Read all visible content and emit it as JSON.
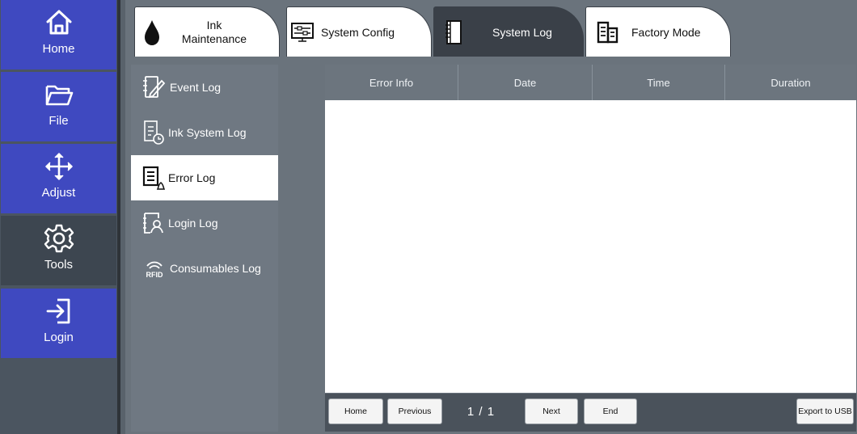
{
  "nav": {
    "items": [
      {
        "label": "Home",
        "icon": "home-icon"
      },
      {
        "label": "File",
        "icon": "folder-icon"
      },
      {
        "label": "Adjust",
        "icon": "move-arrows-icon"
      },
      {
        "label": "Tools",
        "icon": "gear-icon",
        "active": true
      },
      {
        "label": "Login",
        "icon": "login-icon"
      }
    ]
  },
  "tabs": [
    {
      "line1": "Ink",
      "line2": "Maintenance",
      "icon": "ink-drop-icon"
    },
    {
      "label": "System Config",
      "icon": "sliders-icon"
    },
    {
      "label": "System Log",
      "icon": "notebook-icon",
      "active": true
    },
    {
      "label": "Factory Mode",
      "icon": "building-icon"
    }
  ],
  "submenu": [
    {
      "label": "Event Log",
      "icon": "event-log-icon"
    },
    {
      "label": "Ink System Log",
      "icon": "ink-system-log-icon"
    },
    {
      "label": "Error Log",
      "icon": "error-log-icon",
      "active": true
    },
    {
      "label": "Login Log",
      "icon": "login-log-icon"
    },
    {
      "label": "Consumables Log",
      "icon": "rfid-icon",
      "rfid_text": "RFID"
    }
  ],
  "table": {
    "columns": [
      "Error Info",
      "Date",
      "Time",
      "Duration"
    ],
    "rows": []
  },
  "pager": {
    "home": "Home",
    "previous": "Previous",
    "page": "1 / 1",
    "next": "Next",
    "end": "End",
    "export": "Export to USB"
  },
  "colors": {
    "nav_blue": "#3f49c0",
    "nav_active": "#3d4650",
    "frame_gray": "#6a737c",
    "tab_active": "#3a4048"
  }
}
